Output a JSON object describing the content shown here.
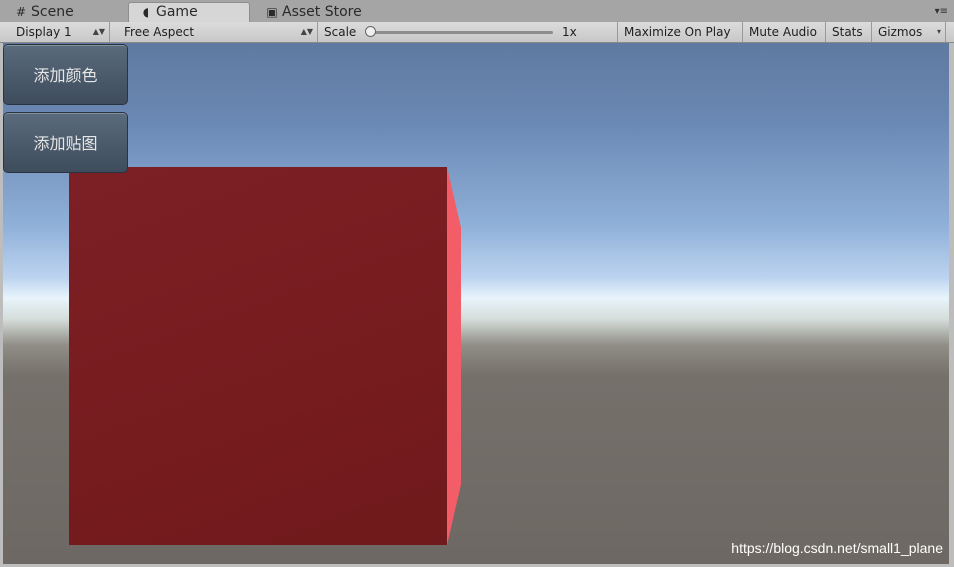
{
  "tabs": {
    "scene": {
      "label": "Scene",
      "icon": "grid-icon"
    },
    "game": {
      "label": "Game",
      "icon": "pacman-icon"
    },
    "asset_store": {
      "label": "Asset Store",
      "icon": "bag-icon"
    }
  },
  "toolbar": {
    "display": "Display 1",
    "aspect": "Free Aspect",
    "scale_label": "Scale",
    "scale_value": "1x",
    "scale_level": 0.0,
    "maximize_on_play": "Maximize On Play",
    "mute_audio": "Mute Audio",
    "stats": "Stats",
    "gizmos": "Gizmos"
  },
  "game_view": {
    "buttons": {
      "add_color": "添加颜色",
      "add_texture": "添加贴图"
    },
    "watermark": "https://blog.csdn.net/small1_plane",
    "colors": {
      "cube_front": "#7a1d22",
      "cube_side": "#f25d67",
      "sky_top": "#5f7aa0",
      "ground": "#6d6863"
    }
  }
}
